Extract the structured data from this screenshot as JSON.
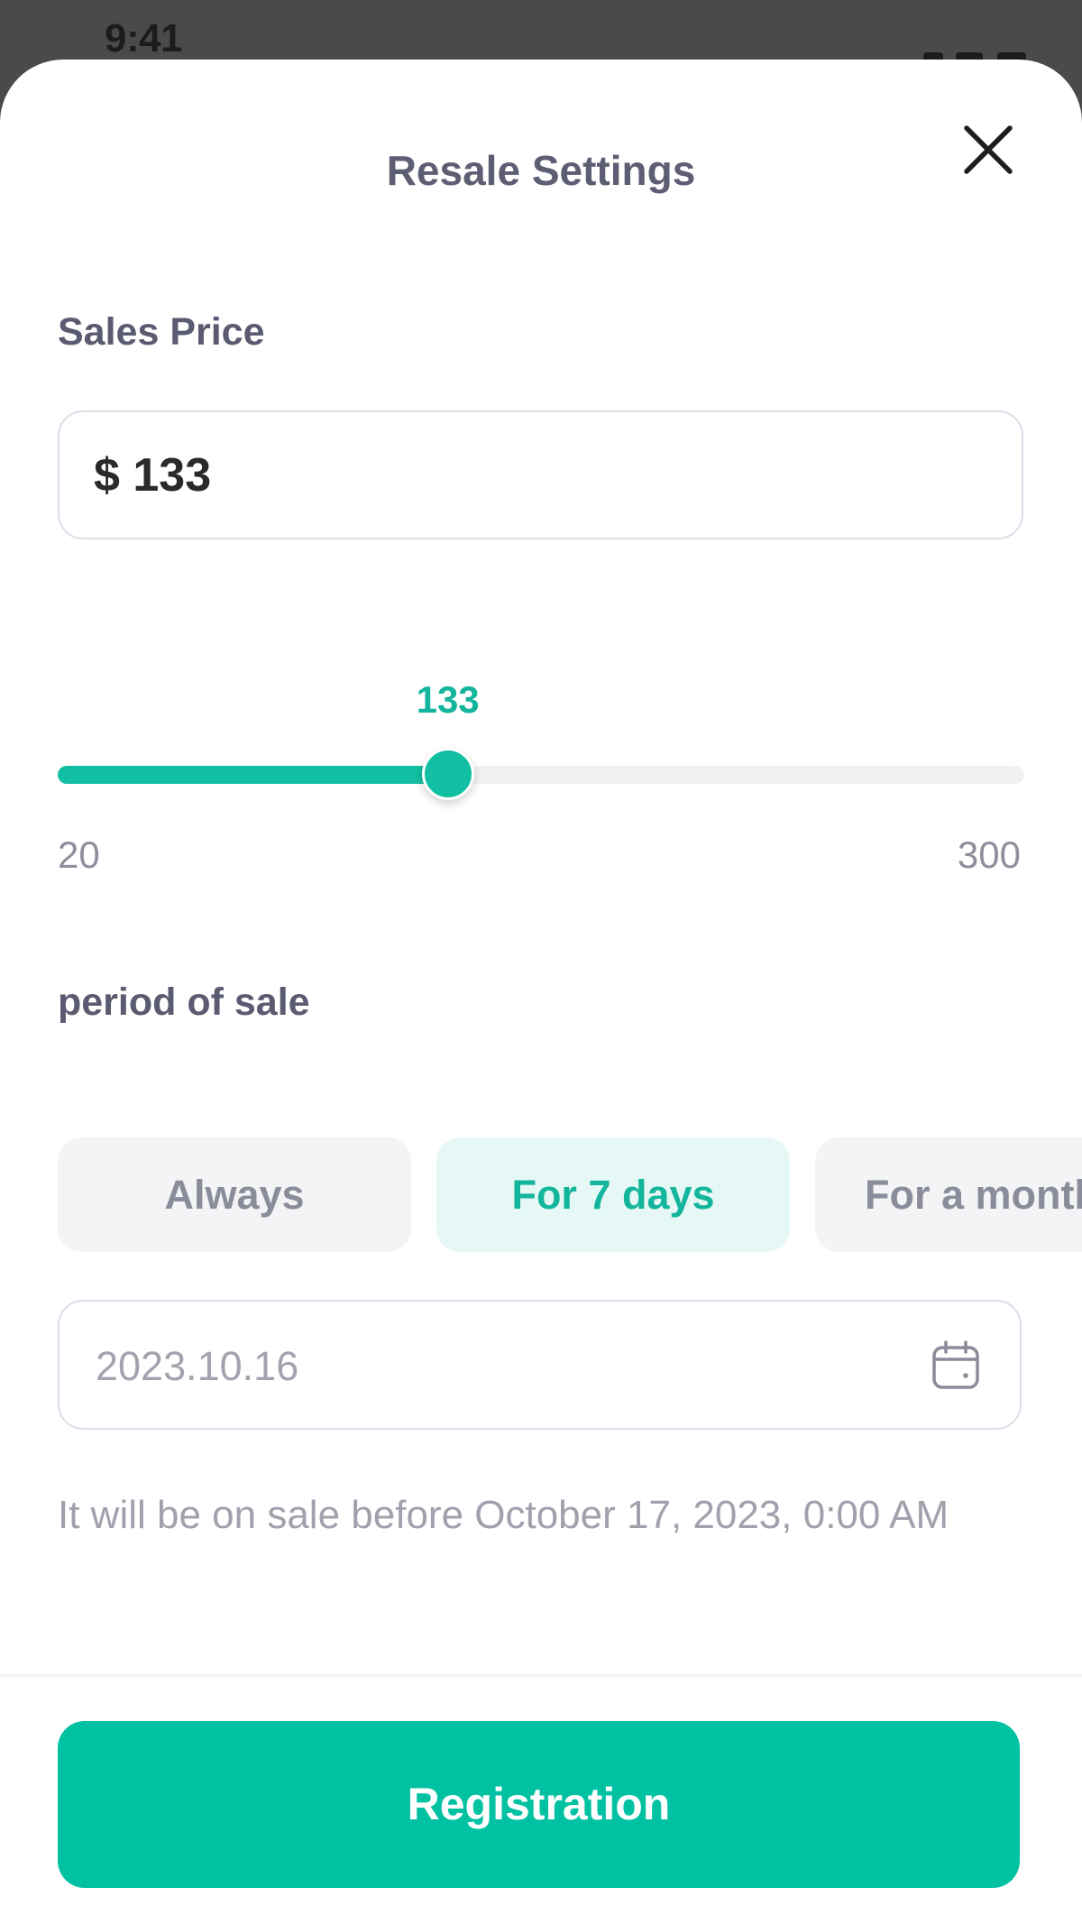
{
  "status_bar": {
    "time": "9:41"
  },
  "header": {
    "title": "Resale Settings",
    "close_icon": "close-icon"
  },
  "sales_price": {
    "label": "Sales Price",
    "value": "$ 133"
  },
  "slider": {
    "value": 133,
    "value_label": "133",
    "min": 20,
    "max": 300,
    "min_label": "20",
    "max_label": "300"
  },
  "period": {
    "label": "period of sale",
    "options": [
      {
        "label": "Always",
        "selected": false
      },
      {
        "label": "For 7 days",
        "selected": true
      },
      {
        "label": "For a month",
        "selected": false
      }
    ]
  },
  "date": {
    "value": "2023.10.16",
    "icon": "calendar-icon"
  },
  "note": "It will be on sale before October 17, 2023, 0:00 AM",
  "submit_label": "Registration",
  "colors": {
    "accent": "#00C2A3",
    "accent_text": "#13B59C",
    "selected_chip_bg": "#E5F8F5",
    "chip_bg": "#F3F4F6",
    "overlay": "#4A4A4A"
  }
}
